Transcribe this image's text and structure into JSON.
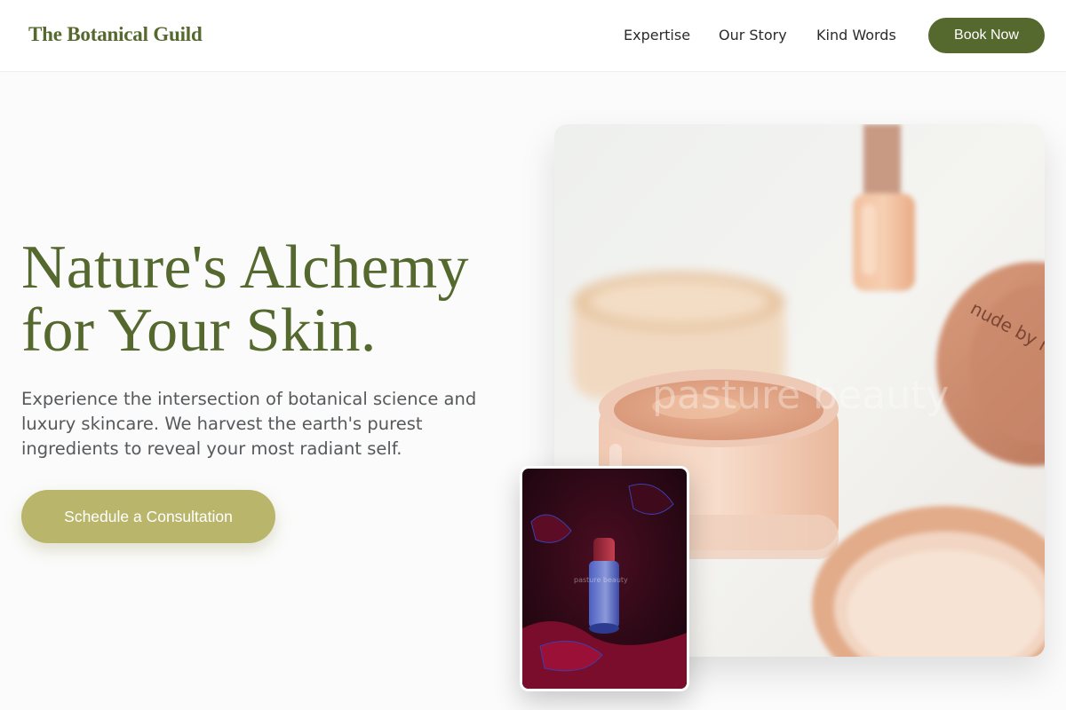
{
  "header": {
    "logo": "The Botanical Guild",
    "nav": [
      "Expertise",
      "Our Story",
      "Kind Words"
    ],
    "book_label": "Book Now"
  },
  "hero": {
    "headline_line1": "Nature's Alchemy",
    "headline_line2": "for Your Skin.",
    "subtext": "Experience the intersection of botanical science and luxury skincare. We harvest the earth's purest ingredients to reveal your most radiant self.",
    "cta_label": "Schedule a Consultation"
  },
  "images": {
    "main": {
      "watermark": "pasture beauty",
      "jar_label": "nude by na"
    },
    "small": {
      "watermark": "pasture beauty"
    }
  },
  "colors": {
    "brand_green": "#55692f",
    "cta_olive": "#b9b66c",
    "text_gray": "#56595c"
  }
}
